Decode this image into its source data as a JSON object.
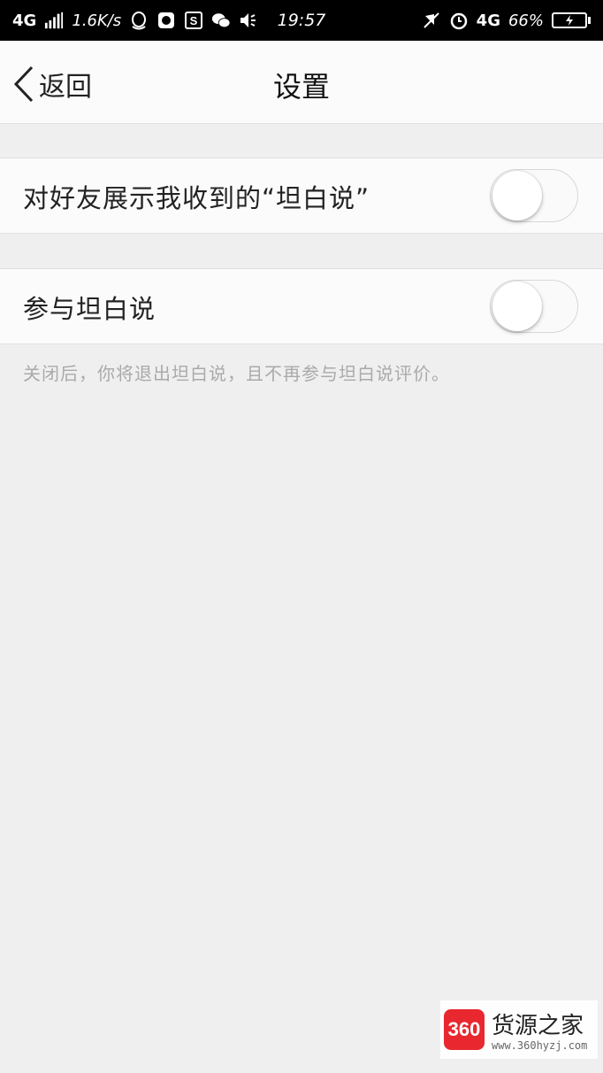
{
  "status_bar": {
    "network_left": "4G",
    "speed": "1.6K/s",
    "time": "19:57",
    "network_right": "4G",
    "battery_percent": "66%",
    "icons_left": [
      "signal-icon",
      "qq-icon",
      "camera-app-icon",
      "s-app-icon",
      "wechat-icon",
      "volume-icon"
    ],
    "icons_right": [
      "mute-icon",
      "alarm-icon",
      "battery-icon"
    ]
  },
  "nav": {
    "back_label": "返回",
    "title": "设置"
  },
  "settings": [
    {
      "label": "对好友展示我收到的“坦白说”",
      "enabled": false
    },
    {
      "label": "参与坦白说",
      "enabled": false
    }
  ],
  "hint": "关闭后，你将退出坦白说，且不再参与坦白说评价。",
  "watermark": {
    "logo_text": "360",
    "title": "货源之家",
    "url": "www.360hyzj.com"
  },
  "colors": {
    "background": "#efefef",
    "row_background": "#fbfbfb",
    "status_bar": "#000000",
    "watermark_red": "#e8272f"
  }
}
